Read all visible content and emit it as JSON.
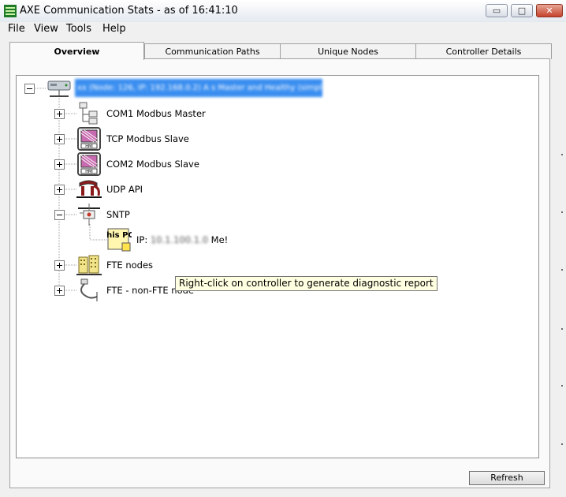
{
  "window": {
    "title": "AXE Communication Stats - as of 16:41:10",
    "controls": {
      "minimize": "▭",
      "maximize": "□",
      "close": "✕"
    }
  },
  "menu": [
    "File",
    "View",
    "Tools",
    "Help"
  ],
  "tabs": [
    {
      "label": "Overview",
      "active": true
    },
    {
      "label": "Communication Paths",
      "active": false
    },
    {
      "label": "Unique Nodes",
      "active": false
    },
    {
      "label": "Controller Details",
      "active": false
    }
  ],
  "tree": {
    "root": {
      "label": "xx (Node: 126, IP: 192.168.0.2) A s Master and Healthy (simplex)",
      "expanded": true,
      "icon": "controller-icon"
    },
    "children": [
      {
        "label": "COM1 Modbus Master",
        "expanded": false,
        "icon": "network-folder-icon"
      },
      {
        "label": "TCP Modbus Slave",
        "expanded": false,
        "icon": "hmi-icon"
      },
      {
        "label": "COM2 Modbus Slave",
        "expanded": false,
        "icon": "hmi-icon"
      },
      {
        "label": "UDP API",
        "expanded": false,
        "icon": "api-icon"
      },
      {
        "label": "SNTP",
        "expanded": true,
        "icon": "sntp-icon",
        "children": [
          {
            "label_prefix": "IP:",
            "ip": "10.1.100.1.0",
            "label_suffix": "Me!",
            "icon_text": "This PC",
            "icon": "this-pc-icon"
          }
        ]
      },
      {
        "label": "FTE nodes",
        "expanded": false,
        "icon": "fte-nodes-icon"
      },
      {
        "label": "FTE - non-FTE node",
        "expanded": false,
        "icon": "non-fte-icon"
      }
    ]
  },
  "tooltip": "Right-click on controller to generate diagnostic report",
  "buttons": {
    "refresh": "Refresh"
  }
}
